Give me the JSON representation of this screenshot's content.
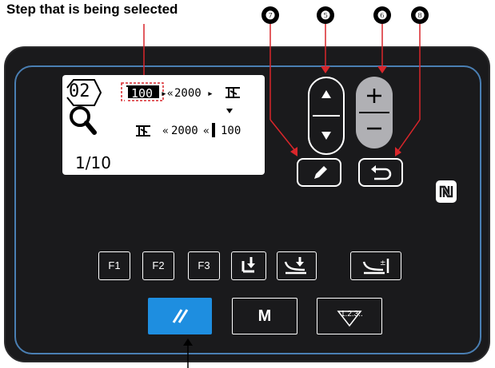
{
  "caption": "Step that is being selected",
  "callouts": [
    "❼",
    "❺",
    "❻",
    "❽"
  ],
  "lcd": {
    "pattern_no": "02",
    "row1_value": "100",
    "row1_count": "2000",
    "row2_count": "2000",
    "row2_value": "100",
    "page": "1/10"
  },
  "function_keys": [
    "F1",
    "F2",
    "F3"
  ],
  "bottom_keys": {
    "reset_symbol": "//",
    "mode_label": "M",
    "counter_label": "1.2.3.."
  },
  "colors": {
    "panel": "#1a1a1c",
    "frame_blue": "#4a7fb3",
    "reset_blue": "#1e8ee0",
    "highlight_red": "#d9262b"
  },
  "icons": [
    "up-arrow-icon",
    "down-arrow-icon",
    "plus-icon",
    "minus-icon",
    "edit-pencil-icon",
    "return-arrow-icon",
    "nfc-icon",
    "search-magnifier-icon",
    "presser-foot-icon",
    "thread-trim-icon",
    "feed-icon",
    "reset-icon",
    "counter-icon"
  ]
}
